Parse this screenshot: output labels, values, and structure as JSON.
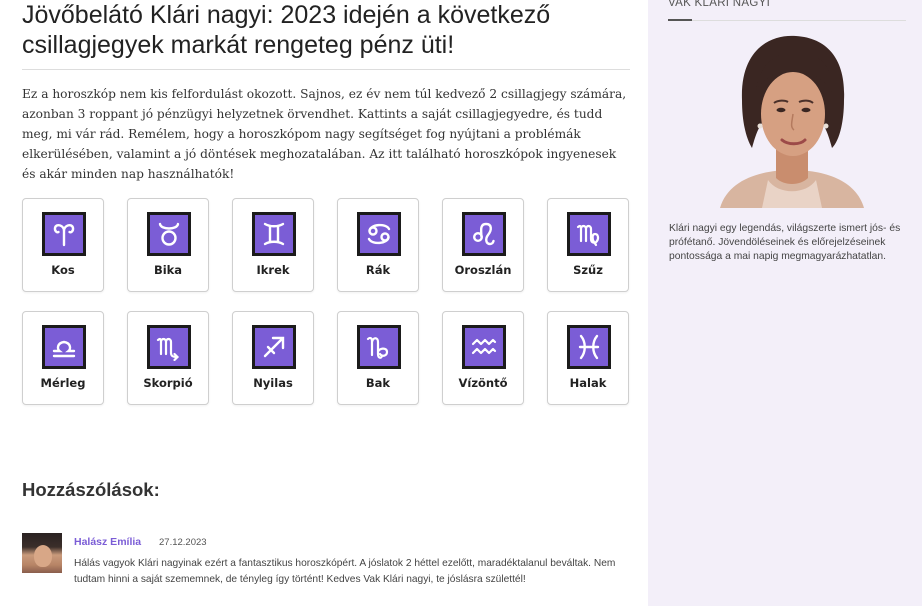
{
  "article": {
    "title_line1": "Jövőbelátó Klári nagyi: 2023 idején a következő",
    "title_line2": "csillagjegyek markát rengeteg pénz üti!",
    "intro": "Ez a horoszkóp nem kis felfordulást okozott. Sajnos, ez év nem túl kedvező 2 csillagjegy számára, azonban 3 roppant jó pénzügyi helyzetnek örvendhet. Kattints a saját csillagjegyedre, és tudd meg, mi vár rád. Remélem, hogy a horoszkópom nagy segítséget fog nyújtani a problémák elkerülésében, valamint a jó döntések meghozatalában. Az itt található horoszkópok ingyenesek és akár minden nap használhatók!"
  },
  "signs": [
    {
      "label": "Kos",
      "icon": "aries-icon"
    },
    {
      "label": "Bika",
      "icon": "taurus-icon"
    },
    {
      "label": "Ikrek",
      "icon": "gemini-icon"
    },
    {
      "label": "Rák",
      "icon": "cancer-icon"
    },
    {
      "label": "Oroszlán",
      "icon": "leo-icon"
    },
    {
      "label": "Szűz",
      "icon": "virgo-icon"
    },
    {
      "label": "Mérleg",
      "icon": "libra-icon"
    },
    {
      "label": "Skorpió",
      "icon": "scorpio-icon"
    },
    {
      "label": "Nyilas",
      "icon": "sagittarius-icon"
    },
    {
      "label": "Bak",
      "icon": "capricorn-icon"
    },
    {
      "label": "Vízöntő",
      "icon": "aquarius-icon"
    },
    {
      "label": "Halak",
      "icon": "pisces-icon"
    }
  ],
  "colors": {
    "sign_fill": "#7b5dd6",
    "sign_border": "#1b1b1b",
    "sidebar_bg": "#f3eff9",
    "accent": "#7b5dd6"
  },
  "comments": {
    "title": "Hozzászólások:",
    "items": [
      {
        "author": "Halász Emília",
        "date": "27.12.2023",
        "text": "Hálás vagyok Klári nagyinak ezért a fantasztikus horoszkópért. A jóslatok 2 héttel ezelőtt, maradéktalanul beváltak. Nem tudtam hinni a saját szememnek, de tényleg így történt! Kedves Vak Klári nagyi, te jóslásra születtél!"
      }
    ]
  },
  "sidebar": {
    "title": "Vak Klári nagyi",
    "bio": "Klári nagyi egy legendás, világszerte ismert jós- és prófétanő. Jövendöléseinek és előrejelzéseinek pontossága a mai napig megmagyarázhatatlan."
  }
}
